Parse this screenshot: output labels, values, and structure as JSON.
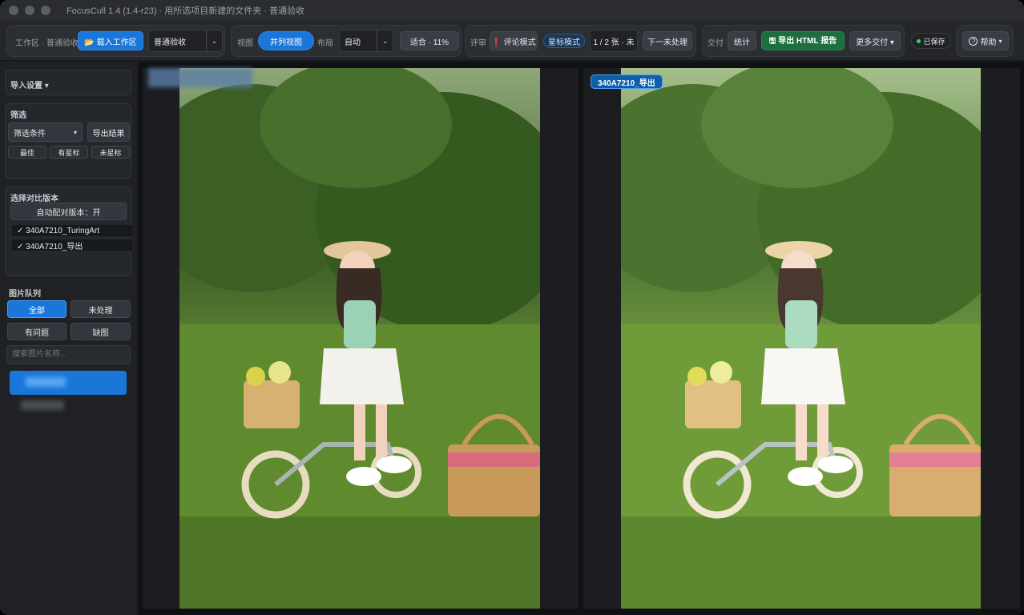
{
  "titlebar": {
    "title": "FocusCull 1.4 (1.4-r23) · 用所选项目新建的文件夹 · 普通验收"
  },
  "toolbar": {
    "workspace_label": "工作区 · 普通验收",
    "load_workspace": "📂 载入工作区",
    "mode_select": "普通验收",
    "view_label": "视图",
    "side_by_side": "并列视图",
    "layout_label": "布局",
    "layout_select": "自动",
    "fit_zoom": "适合 · 11%",
    "review_label": "评审",
    "comment_mode": "❗ 评论模式",
    "star_mode": "星标模式",
    "counter": "1 / 2 张 · 未",
    "next_unprocessed": "下一未处理",
    "deliver_label": "交付",
    "stats": "统计",
    "export_html": "🖫 导出 HTML 报告",
    "more_deliver": "更多交付 ▾",
    "saved": "已保存",
    "help": "帮助"
  },
  "sidebar": {
    "import_settings": "导入设置 ▾",
    "filter_title": "筛选",
    "filter_select": "筛选条件",
    "export_results": "导出结果",
    "filter_tags": [
      "最佳",
      "有星标",
      "未星标"
    ],
    "compare_title": "选择对比版本",
    "auto_pair": "自动配对版本：开",
    "versions": [
      "✓ 340A7210_TuringArt",
      "✓ 340A7210_导出"
    ],
    "queue_title": "图片队列",
    "queue_filters": [
      "全部",
      "未处理",
      "有问题",
      "缺图"
    ],
    "search_placeholder": "搜索图片名称..."
  },
  "viewer": {
    "right_label": "340A7210_导出"
  },
  "colors": {
    "accent": "#1a77d9",
    "success": "#1f6e3f",
    "background": "#1c1e22"
  }
}
